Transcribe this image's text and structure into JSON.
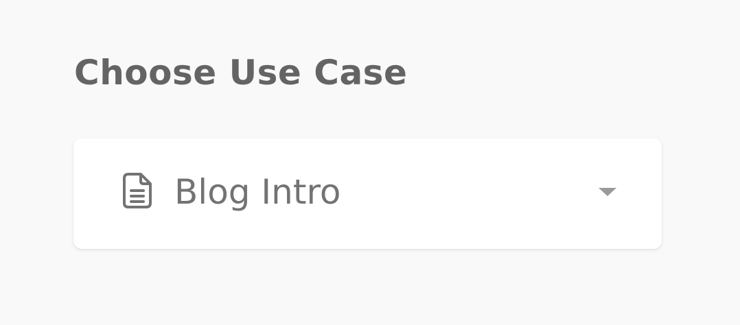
{
  "heading": {
    "title": "Choose Use Case"
  },
  "use_case_select": {
    "selected_value": "Blog Intro",
    "icon": "document-icon",
    "dropdown_icon": "caret-down-icon"
  },
  "colors": {
    "background": "#f9f9f9",
    "text_heading": "#646464",
    "text_value": "#737373",
    "caret": "#9a9a9a"
  }
}
